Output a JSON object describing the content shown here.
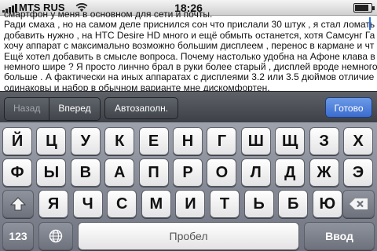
{
  "status_bar": {
    "carrier": "MTS RUS",
    "time": "18:26",
    "battery_level": 0.85
  },
  "content": {
    "lines": [
      "смартфон у меня в основном для сети и почты.",
      "Ради смаха , но на самом деле приснился сон что прислали 30 штук , я стал ломать",
      "добавить нужно , на HTC Desire HD много и ещё обмыть останется, хотя Самсунг Га",
      "хочу аппарат с максимально возможно большим дисплеем , перенос в кармане и чт",
      "Ещё хотел добавить в смысле вопроса. Почему настолько удобна на Афоне клава в",
      "немного шире ? Я просто линчно брал в руки более старый , дисплей вроде немного",
      "больше . А фактически на иных аппаратах с дисплеями 3.2 или 3.5 дюймов отличие",
      "одинаковы и набор в обычном варианте мне дискомфортен."
    ]
  },
  "form_assistant": {
    "prev_label": "Назад",
    "next_label": "Вперед",
    "autofill_label": "Автозаполн.",
    "done_label": "Готово"
  },
  "keyboard": {
    "row1": [
      "Й",
      "Ц",
      "У",
      "К",
      "Е",
      "Н",
      "Г",
      "Ш",
      "Щ",
      "З",
      "Х"
    ],
    "row2": [
      "Ф",
      "Ы",
      "В",
      "А",
      "П",
      "Р",
      "О",
      "Л",
      "Д",
      "Ж",
      "Э"
    ],
    "row3": [
      "Я",
      "Ч",
      "С",
      "М",
      "И",
      "Т",
      "Ь",
      "Б",
      "Ю"
    ],
    "numbers_label": "123",
    "space_label": "Пробел",
    "return_label": "Ввод",
    "shift_icon": "shift-arrow-icon",
    "backspace_icon": "backspace-icon",
    "globe_icon": "globe-icon"
  }
}
